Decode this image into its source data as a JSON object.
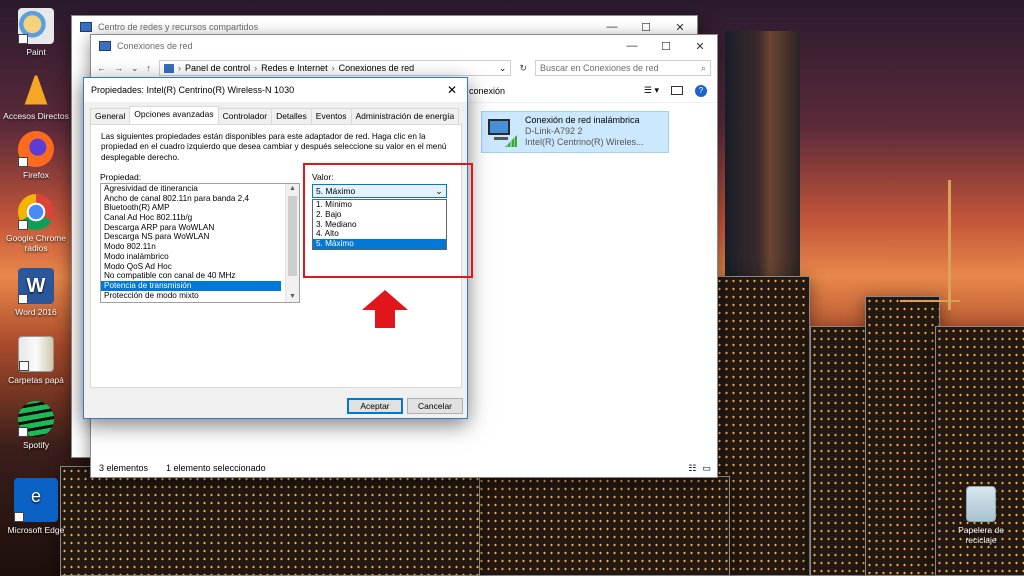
{
  "desktop": {
    "icons": [
      {
        "label": "Paint"
      },
      {
        "label": "Accesos Directos"
      },
      {
        "label": "Firefox"
      },
      {
        "label": "Google Chrome radios"
      },
      {
        "label": "Word 2016"
      },
      {
        "label": "Carpetas papá"
      },
      {
        "label": "Spotify"
      },
      {
        "label": "Microsoft Edge"
      }
    ],
    "recycle_bin": "Papelera de reciclaje"
  },
  "back_window": {
    "title": "Centro de redes y recursos compartidos"
  },
  "net_window": {
    "title": "Conexiones de red",
    "breadcrumb": [
      "Panel de control",
      "Redes e Internet",
      "Conexiones de red"
    ],
    "search_placeholder": "Buscar en Conexiones de red",
    "toolbar_fragment": "conexión",
    "item": {
      "name": "Conexión de red inalámbrica",
      "network": "D-Link-A792  2",
      "adapter": "Intel(R) Centrino(R) Wireles..."
    },
    "status": {
      "count": "3 elementos",
      "selected": "1 elemento seleccionado"
    }
  },
  "dialog": {
    "title": "Propiedades: Intel(R) Centrino(R) Wireless-N 1030",
    "tabs": [
      "General",
      "Opciones avanzadas",
      "Controlador",
      "Detalles",
      "Eventos",
      "Administración de energía"
    ],
    "active_tab": "Opciones avanzadas",
    "description": "Las siguientes propiedades están disponibles para este adaptador de red. Haga clic en la propiedad en el cuadro izquierdo que desea cambiar y después seleccione su valor en el menú desplegable derecho.",
    "property_label": "Propiedad:",
    "value_label": "Valor:",
    "properties": [
      "Agresividad de itinerancia",
      "Ancho de canal 802.11n para banda 2,4",
      "Bluetooth(R) AMP",
      "Canal Ad Hoc 802.11b/g",
      "Descarga ARP para WoWLAN",
      "Descarga NS para WoWLAN",
      "Modo 802.11n",
      "Modo inalámbrico",
      "Modo QoS Ad Hoc",
      "No compatible con canal de 40 MHz",
      "Potencia de transmisión",
      "Protección de modo mixto"
    ],
    "selected_property": "Potencia de transmisión",
    "value_selected": "5. Máximo",
    "value_options": [
      "1. Mínimo",
      "2. Bajo",
      "3. Mediano",
      "4. Alto",
      "5. Máximo"
    ],
    "ok_label": "Aceptar",
    "cancel_label": "Cancelar"
  },
  "colors": {
    "accent": "#0078d7",
    "annotation": "#e0161c"
  }
}
